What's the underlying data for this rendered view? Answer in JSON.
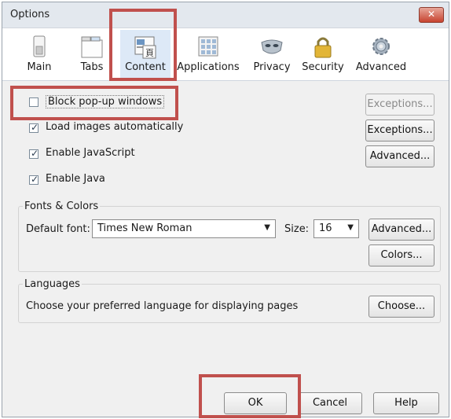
{
  "window": {
    "title": "Options",
    "close_label": "✕"
  },
  "tabs": [
    {
      "id": "main",
      "label": "Main",
      "icon": "switch-icon",
      "selected": false
    },
    {
      "id": "tabs",
      "label": "Tabs",
      "icon": "tabs-icon",
      "selected": false
    },
    {
      "id": "content",
      "label": "Content",
      "icon": "content-icon",
      "selected": true
    },
    {
      "id": "applications",
      "label": "Applications",
      "icon": "applications-icon",
      "selected": false
    },
    {
      "id": "privacy",
      "label": "Privacy",
      "icon": "mask-icon",
      "selected": false
    },
    {
      "id": "security",
      "label": "Security",
      "icon": "lock-icon",
      "selected": false
    },
    {
      "id": "advanced",
      "label": "Advanced",
      "icon": "gear-icon",
      "selected": false
    }
  ],
  "content": {
    "block_popups": {
      "label": "Block pop-up windows",
      "checked": false,
      "exceptions_label": "Exceptions...",
      "exceptions_enabled": false
    },
    "load_images": {
      "label": "Load images automatically",
      "checked": true,
      "exceptions_label": "Exceptions..."
    },
    "javascript": {
      "label": "Enable JavaScript",
      "checked": true,
      "advanced_label": "Advanced..."
    },
    "java": {
      "label": "Enable Java",
      "checked": true
    }
  },
  "fonts": {
    "title": "Fonts & Colors",
    "default_font_label": "Default font:",
    "default_font_value": "Times New Roman",
    "size_label": "Size:",
    "size_value": "16",
    "advanced_label": "Advanced...",
    "colors_label": "Colors..."
  },
  "languages": {
    "title": "Languages",
    "description": "Choose your preferred language for displaying pages",
    "choose_label": "Choose..."
  },
  "buttons": {
    "ok": "OK",
    "cancel": "Cancel",
    "help": "Help"
  },
  "colors": {
    "highlight": "#c0504d",
    "selected_tab": "#dde9f7"
  }
}
